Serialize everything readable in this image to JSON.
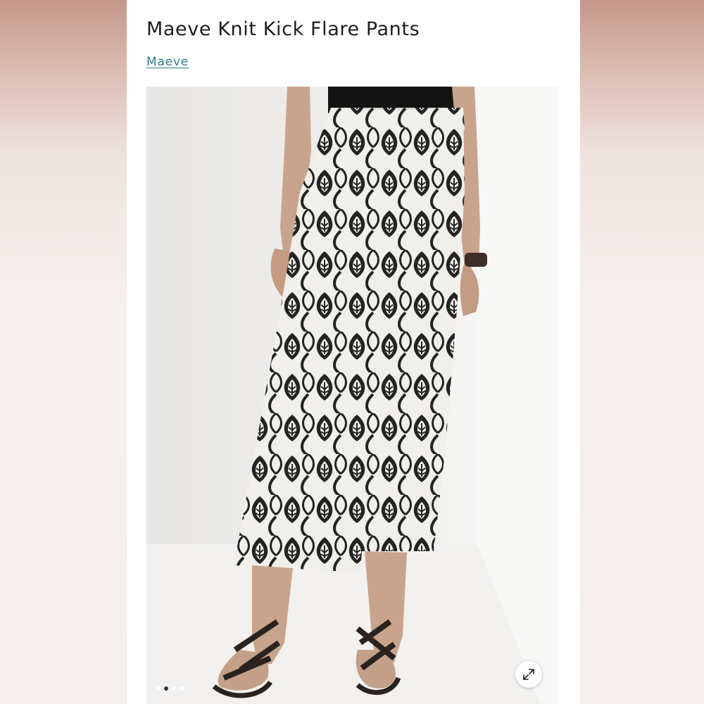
{
  "product": {
    "title": "Maeve Knit Kick Flare Pants",
    "brand_link": "Maeve"
  },
  "gallery": {
    "image_alt": "Model wearing black and white patterned knit kick flare pants with strappy black sandals",
    "expand_icon": "expand-diagonal-arrows-icon",
    "slide_count": 4,
    "active_slide": 2
  },
  "colors": {
    "link": "#2f7d8a",
    "title": "#1d1d1d"
  }
}
